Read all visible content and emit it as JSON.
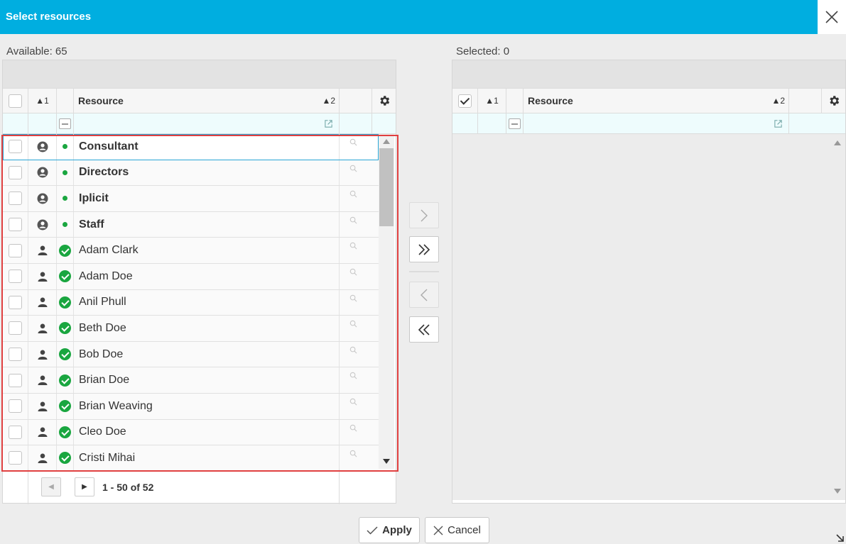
{
  "dialog": {
    "title": "Select resources",
    "close_icon": "close-icon"
  },
  "available": {
    "label": "Available: 65",
    "columns": {
      "sort1": "▲1",
      "resource": "Resource",
      "sort2": "▲2"
    },
    "rows": [
      {
        "name": "Consultant",
        "bold": true,
        "type": "group-icon",
        "status": "dot"
      },
      {
        "name": "Directors",
        "bold": true,
        "type": "group-icon",
        "status": "dot"
      },
      {
        "name": "Iplicit",
        "bold": true,
        "type": "group-icon",
        "status": "dot"
      },
      {
        "name": "Staff",
        "bold": true,
        "type": "group-icon",
        "status": "dot"
      },
      {
        "name": "Adam Clark",
        "bold": false,
        "type": "person-icon",
        "status": "check"
      },
      {
        "name": "Adam Doe",
        "bold": false,
        "type": "person-icon",
        "status": "check"
      },
      {
        "name": "Anil Phull",
        "bold": false,
        "type": "person-icon",
        "status": "check"
      },
      {
        "name": "Beth Doe",
        "bold": false,
        "type": "person-icon",
        "status": "check"
      },
      {
        "name": "Bob Doe",
        "bold": false,
        "type": "person-icon",
        "status": "check"
      },
      {
        "name": "Brian Doe",
        "bold": false,
        "type": "person-icon",
        "status": "check"
      },
      {
        "name": "Brian Weaving",
        "bold": false,
        "type": "person-icon",
        "status": "check"
      },
      {
        "name": "Cleo Doe",
        "bold": false,
        "type": "person-icon",
        "status": "check"
      },
      {
        "name": "Cristi Mihai",
        "bold": false,
        "type": "person-icon",
        "status": "check"
      }
    ],
    "pager_text": "1 - 50 of 52"
  },
  "selected": {
    "label": "Selected: 0",
    "columns": {
      "sort1": "▲1",
      "resource": "Resource",
      "sort2": "▲2"
    }
  },
  "footer": {
    "apply_label": "Apply",
    "cancel_label": "Cancel"
  },
  "colors": {
    "titlebar": "#00aee0",
    "status_green": "#1aa640",
    "highlight": "#e04040"
  }
}
